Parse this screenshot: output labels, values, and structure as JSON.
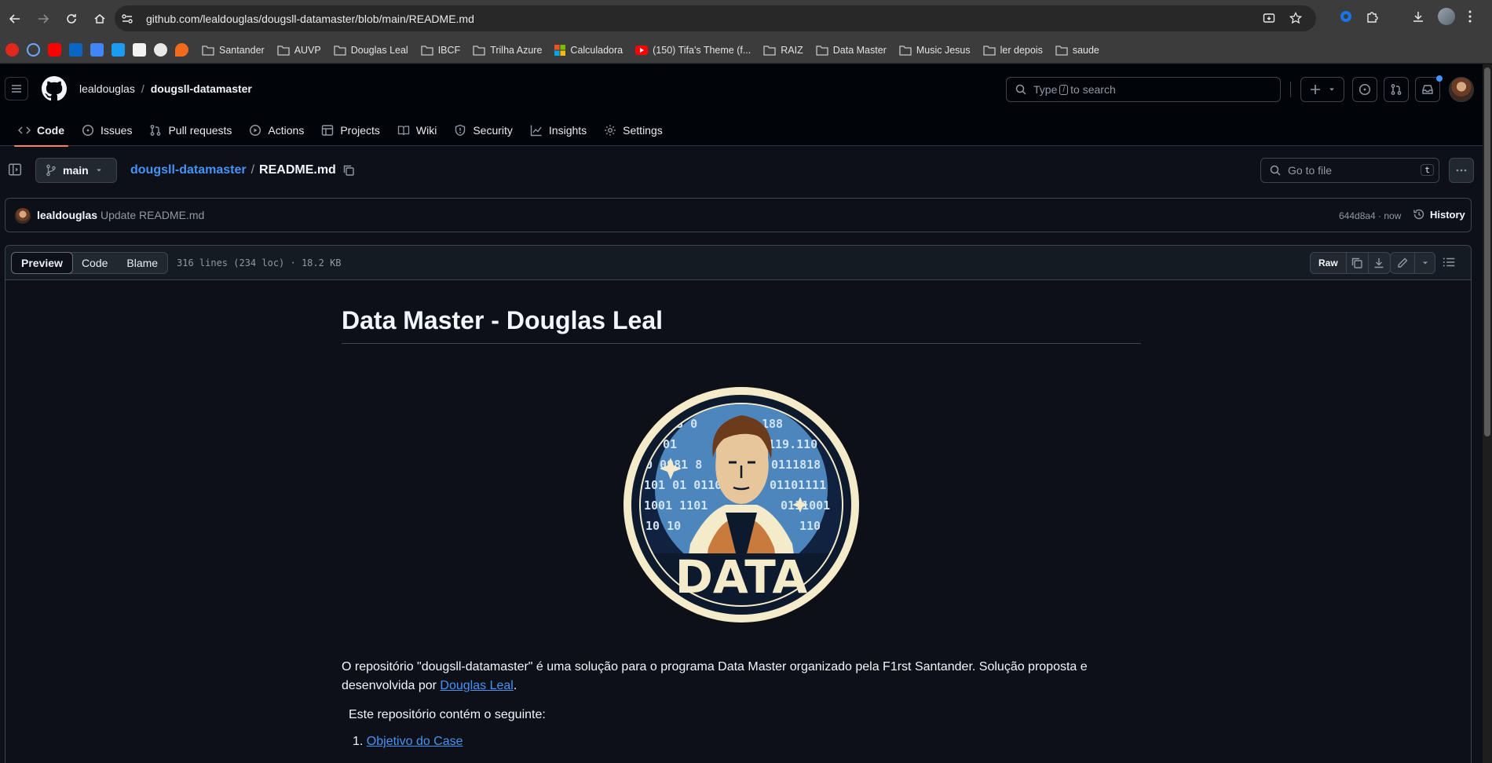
{
  "browser": {
    "url": "github.com/lealdouglas/dougsll-datamaster/blob/main/README.md",
    "bookmarks": [
      {
        "label": "Santander"
      },
      {
        "label": "AUVP"
      },
      {
        "label": "Douglas Leal"
      },
      {
        "label": "IBCF"
      },
      {
        "label": "Trilha Azure"
      },
      {
        "label": "Calculadora"
      },
      {
        "label": "(150) Tifa's Theme (f..."
      },
      {
        "label": "RAIZ"
      },
      {
        "label": "Data Master"
      },
      {
        "label": "Music Jesus"
      },
      {
        "label": "ler depois"
      },
      {
        "label": "saude"
      }
    ]
  },
  "header": {
    "owner": "lealdouglas",
    "separator": "/",
    "repo": "dougsll-datamaster",
    "search_prefix": "Type",
    "search_key": "/",
    "search_suffix": "to search"
  },
  "tabs": [
    {
      "label": "Code"
    },
    {
      "label": "Issues"
    },
    {
      "label": "Pull requests"
    },
    {
      "label": "Actions"
    },
    {
      "label": "Projects"
    },
    {
      "label": "Wiki"
    },
    {
      "label": "Security"
    },
    {
      "label": "Insights"
    },
    {
      "label": "Settings"
    }
  ],
  "file_bar": {
    "branch": "main",
    "crumb_repo": "dougsll-datamaster",
    "crumb_sep": "/",
    "crumb_file": "README.md",
    "goto_placeholder": "Go to file",
    "goto_key": "t"
  },
  "commit": {
    "author": "lealdouglas",
    "message": "Update README.md",
    "meta": "644d8a4 · now",
    "history_label": "History"
  },
  "file_toolbar": {
    "modes": [
      "Preview",
      "Code",
      "Blame"
    ],
    "info": "316 lines (234 loc) · 18.2 KB",
    "raw_label": "Raw"
  },
  "readme": {
    "title": "Data Master - Douglas Leal",
    "logo_text": "DATA",
    "intro_before": "O repositório \"dougsll-datamaster\" é uma solução para o programa Data Master organizado pela F1rst Santander. Solução proposta e desenvolvida por ",
    "intro_link": "Douglas Leal",
    "intro_after": ".",
    "contains": "Este repositório contém o seguinte:",
    "list_number": "1.",
    "list_item_1": "Objetivo do Case"
  },
  "colors": {
    "bg": "#0d1117",
    "header_bg": "#010409",
    "accent_link": "#4493f8",
    "active_tab_underline": "#f78166"
  }
}
